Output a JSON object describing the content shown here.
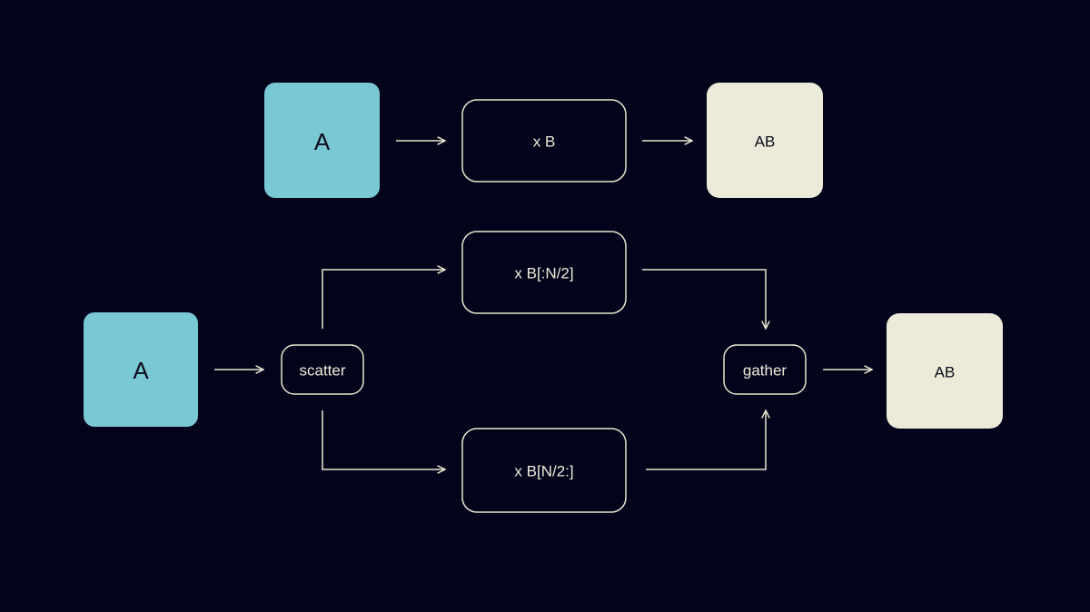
{
  "colors": {
    "background": "#03041c",
    "matrix_a": "#7ac8d4",
    "result": "#ecebd9",
    "stroke": "#e8e6cf"
  },
  "top": {
    "input": "A",
    "op": "x B",
    "output": "AB"
  },
  "bottom": {
    "input": "A",
    "scatter": "scatter",
    "op_top": "x B[:N/2]",
    "op_bottom": "x B[N/2:]",
    "gather": "gather",
    "output": "AB"
  }
}
